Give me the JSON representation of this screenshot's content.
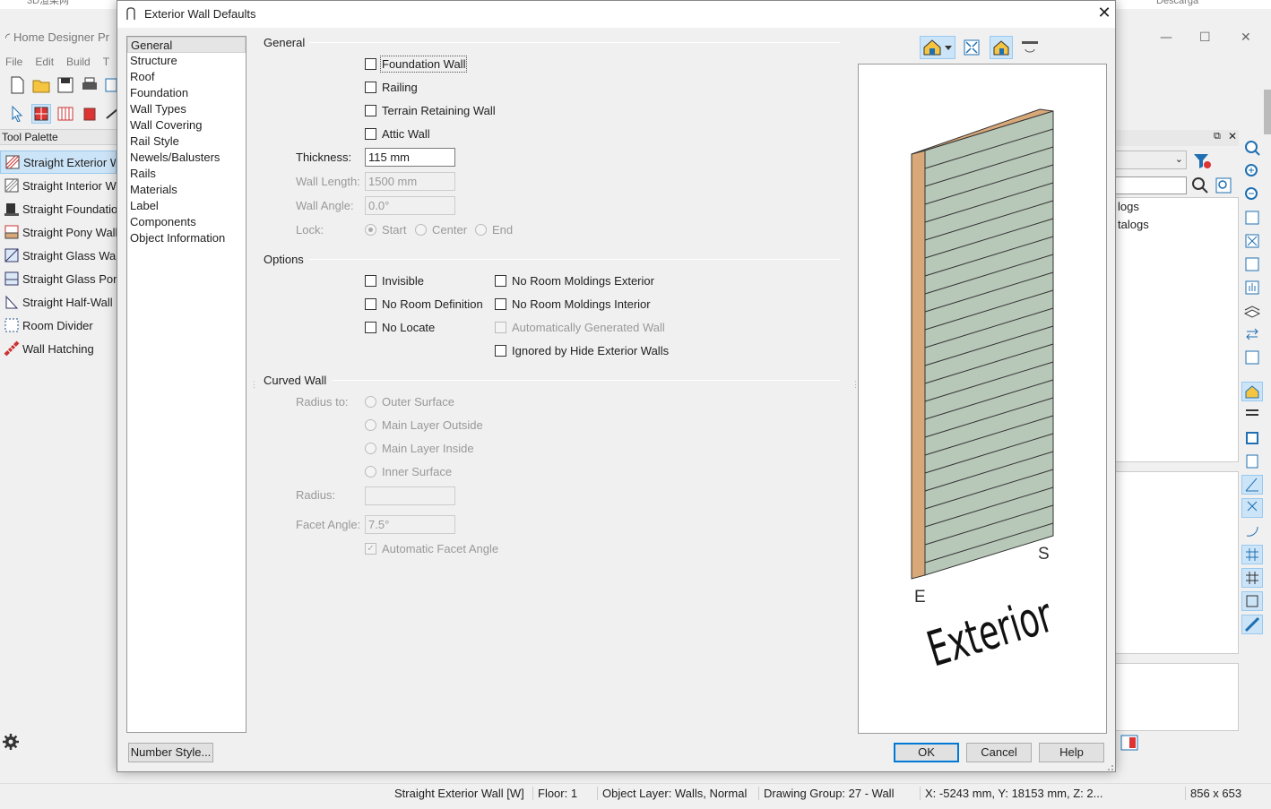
{
  "background_app": {
    "top_tabs": [
      "3D渲染网",
      "Descarga"
    ],
    "title": "Home Designer Pr",
    "menu": [
      "File",
      "Edit",
      "Build",
      "T"
    ],
    "palette_header": "Tool Palette",
    "palette_items": [
      {
        "label": "Straight Exterior W",
        "icon": "exterior-wall-icon",
        "selected": true
      },
      {
        "label": "Straight Interior W",
        "icon": "interior-wall-icon",
        "selected": false
      },
      {
        "label": "Straight Foundatio",
        "icon": "foundation-wall-icon",
        "selected": false
      },
      {
        "label": "Straight Pony Wall",
        "icon": "pony-wall-icon",
        "selected": false
      },
      {
        "label": "Straight Glass Wal",
        "icon": "glass-wall-icon",
        "selected": false
      },
      {
        "label": "Straight Glass Pon",
        "icon": "glass-pony-wall-icon",
        "selected": false
      },
      {
        "label": "Straight Half-Wall",
        "icon": "half-wall-icon",
        "selected": false
      },
      {
        "label": "Room Divider",
        "icon": "room-divider-icon",
        "selected": false
      },
      {
        "label": "Wall Hatching",
        "icon": "wall-hatching-icon",
        "selected": false
      }
    ],
    "library_items": [
      "logs",
      "talogs"
    ],
    "status": {
      "tool": "Straight Exterior Wall [W]",
      "floor": "Floor: 1",
      "layer": "Object Layer: Walls,  Normal",
      "group": "Drawing Group: 27 - Wall",
      "coords": "X: -5243 mm, Y: 18153 mm, Z: 2...",
      "size": "856 x 653"
    }
  },
  "dialog": {
    "title": "Exterior Wall Defaults",
    "close_glyph": "✕",
    "nav": [
      "General",
      "Structure",
      "Roof",
      "Foundation",
      "Wall Types",
      "Wall Covering",
      "Rail Style",
      "Newels/Balusters",
      "Rails",
      "Materials",
      "Label",
      "Components",
      "Object Information"
    ],
    "nav_selected": "General",
    "general": {
      "heading": "General",
      "checks": [
        "Foundation Wall",
        "Railing",
        "Terrain Retaining Wall",
        "Attic Wall"
      ],
      "thickness_label": "Thickness:",
      "thickness_value": "115 mm",
      "length_label": "Wall Length:",
      "length_value": "1500 mm",
      "angle_label": "Wall Angle:",
      "angle_value": "0.0°",
      "lock_label": "Lock:",
      "lock_options": [
        "Start",
        "Center",
        "End"
      ],
      "lock_selected": "Start"
    },
    "options": {
      "heading": "Options",
      "col1": [
        "Invisible",
        "No Room Definition",
        "No Locate"
      ],
      "col2": [
        "No Room Moldings Exterior",
        "No Room Moldings Interior",
        "Automatically Generated Wall",
        "Ignored by Hide Exterior Walls"
      ]
    },
    "curved": {
      "heading": "Curved Wall",
      "radius_to_label": "Radius to:",
      "radius_to_options": [
        "Outer Surface",
        "Main Layer Outside",
        "Main Layer Inside",
        "Inner Surface"
      ],
      "radius_label": "Radius:",
      "radius_value": "",
      "facet_label": "Facet Angle:",
      "facet_value": "7.5°",
      "auto_facet": "Automatic Facet Angle",
      "auto_facet_checked": true
    },
    "preview": {
      "exterior_label": "Exterior",
      "mark_e": "E",
      "mark_s": "S",
      "wall_face_color": "#b7c7b8",
      "wall_edge_color": "#d9a878"
    },
    "buttons": {
      "number_style": "Number Style...",
      "ok": "OK",
      "cancel": "Cancel",
      "help": "Help"
    }
  }
}
